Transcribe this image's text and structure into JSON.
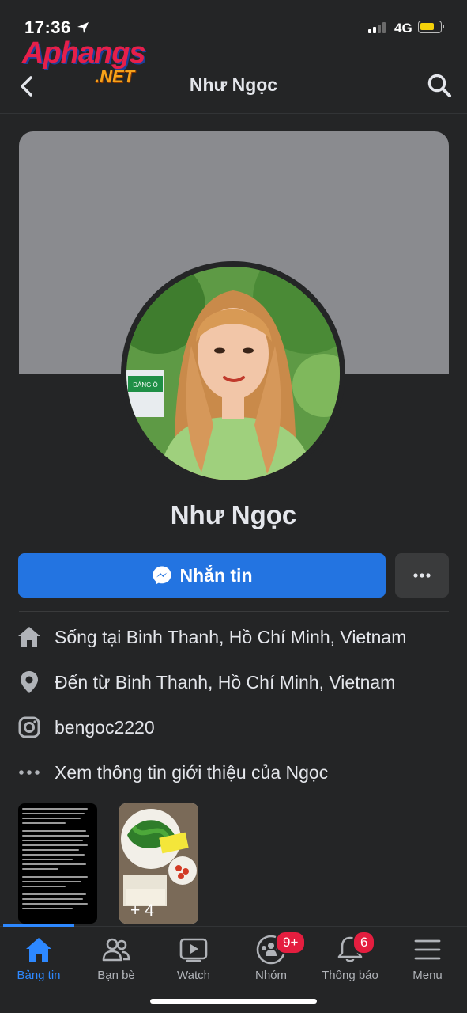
{
  "status": {
    "time": "17:36",
    "network": "4G"
  },
  "watermark": {
    "brand": "Aphangs",
    "suffix": ".NET"
  },
  "header": {
    "title": "Như Ngọc"
  },
  "profile": {
    "name": "Như Ngọc",
    "message_button": "Nhắn tin",
    "avatar_sign_text": "DÁNG Ô"
  },
  "info": [
    {
      "icon": "home-icon",
      "text": "Sống tại Binh Thanh, Hồ Chí Minh, Vietnam"
    },
    {
      "icon": "location-pin-icon",
      "text": "Đến từ Binh Thanh, Hồ Chí Minh, Vietnam"
    },
    {
      "icon": "instagram-icon",
      "text": "bengoc2220"
    },
    {
      "icon": "more-dots-icon",
      "text": "Xem thông tin giới thiệu của Ngọc"
    }
  ],
  "photos": {
    "more_count": "+ 4"
  },
  "tabs": [
    {
      "label": "Bảng tin",
      "icon": "home-tab-icon",
      "badge": ""
    },
    {
      "label": "Bạn bè",
      "icon": "friends-icon",
      "badge": ""
    },
    {
      "label": "Watch",
      "icon": "watch-icon",
      "badge": ""
    },
    {
      "label": "Nhóm",
      "icon": "groups-icon",
      "badge": "9+"
    },
    {
      "label": "Thông báo",
      "icon": "bell-icon",
      "badge": "6"
    },
    {
      "label": "Menu",
      "icon": "menu-icon",
      "badge": ""
    }
  ],
  "colors": {
    "accent": "#2374e1",
    "active_tab": "#2d88ff",
    "badge": "#e41e3f",
    "background": "#242526"
  }
}
